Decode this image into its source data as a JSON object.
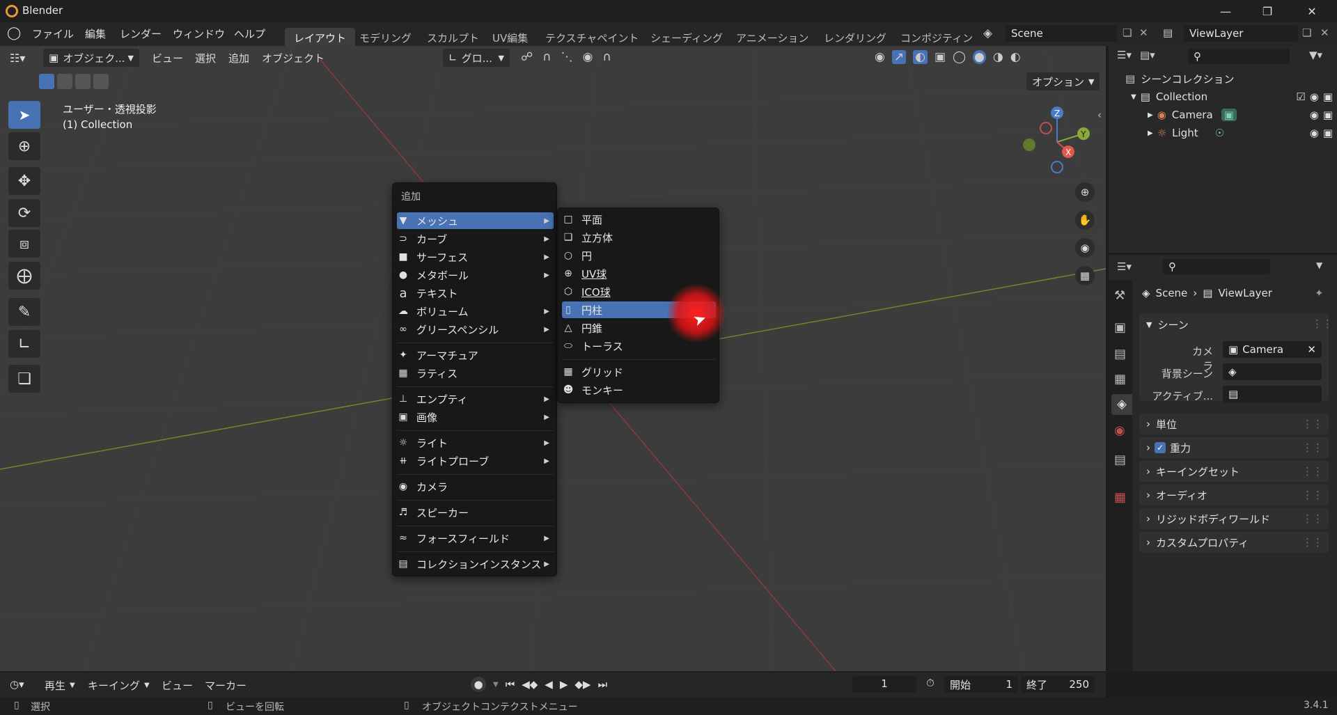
{
  "app": {
    "title": "Blender",
    "version": "3.4.1"
  },
  "menubar": [
    "ファイル",
    "編集",
    "レンダー",
    "ウィンドウ",
    "ヘルプ"
  ],
  "workspaces": [
    {
      "label": "レイアウト",
      "active": true
    },
    {
      "label": "モデリング"
    },
    {
      "label": "スカルプト"
    },
    {
      "label": "UV編集"
    },
    {
      "label": "テクスチャペイント"
    },
    {
      "label": "シェーディング"
    },
    {
      "label": "アニメーション"
    },
    {
      "label": "レンダリング"
    },
    {
      "label": "コンポジティン"
    }
  ],
  "scene": {
    "name": "Scene",
    "view_layer": "ViewLayer"
  },
  "viewport_header": {
    "mode": "オブジェク...",
    "menus": [
      "ビュー",
      "選択",
      "追加",
      "オブジェクト"
    ],
    "transform": "グロ...",
    "options": "オプション"
  },
  "viewport": {
    "overlay_line1": "ユーザー・透視投影",
    "overlay_line2": "(1) Collection",
    "gizmo": {
      "z": "Z",
      "y": "Y",
      "x": "X"
    }
  },
  "add_menu": {
    "title": "追加",
    "items": [
      {
        "label": "メッシュ",
        "icon": "mesh-icon",
        "sub": true,
        "highlight": true
      },
      {
        "label": "カーブ",
        "icon": "curve-icon",
        "sub": true
      },
      {
        "label": "サーフェス",
        "icon": "surface-icon",
        "sub": true
      },
      {
        "label": "メタボール",
        "icon": "metaball-icon",
        "sub": true
      },
      {
        "label": "テキスト",
        "icon": "text-icon"
      },
      {
        "label": "ボリューム",
        "icon": "volume-icon",
        "sub": true
      },
      {
        "label": "グリースペンシル",
        "icon": "grease-pencil-icon",
        "sub": true
      },
      {
        "label": "アーマチュア",
        "icon": "armature-icon"
      },
      {
        "label": "ラティス",
        "icon": "lattice-icon"
      },
      {
        "label": "エンプティ",
        "icon": "empty-icon",
        "sub": true
      },
      {
        "label": "画像",
        "icon": "image-icon",
        "sub": true
      },
      {
        "label": "ライト",
        "icon": "light-icon",
        "sub": true
      },
      {
        "label": "ライトプローブ",
        "icon": "light-probe-icon",
        "sub": true
      },
      {
        "label": "カメラ",
        "icon": "camera-icon"
      },
      {
        "label": "スピーカー",
        "icon": "speaker-icon"
      },
      {
        "label": "フォースフィールド",
        "icon": "force-field-icon",
        "sub": true
      },
      {
        "label": "コレクションインスタンス",
        "icon": "collection-instance-icon",
        "sub": true
      }
    ]
  },
  "mesh_submenu": {
    "items": [
      {
        "label": "平面",
        "icon": "plane-icon"
      },
      {
        "label": "立方体",
        "icon": "cube-icon"
      },
      {
        "label": "円",
        "icon": "circle-icon"
      },
      {
        "label": "UV球",
        "icon": "uv-sphere-icon"
      },
      {
        "label": "ICO球",
        "icon": "ico-sphere-icon"
      },
      {
        "label": "円柱",
        "icon": "cylinder-icon",
        "highlight": true
      },
      {
        "label": "円錐",
        "icon": "cone-icon"
      },
      {
        "label": "トーラス",
        "icon": "torus-icon"
      },
      {
        "label": "グリッド",
        "icon": "grid-icon"
      },
      {
        "label": "モンキー",
        "icon": "monkey-icon"
      }
    ]
  },
  "outliner": {
    "root": "シーンコレクション",
    "collection": "Collection",
    "objects": [
      "Camera",
      "Light"
    ]
  },
  "properties": {
    "breadcrumb_scene": "Scene",
    "breadcrumb_layer": "ViewLayer",
    "scene_panel": "シーン",
    "camera_label": "カメラ",
    "camera_value": "Camera",
    "background_label": "背景シーン",
    "active_label": "アクティブ...",
    "panels": [
      "単位",
      "重力",
      "キーイングセット",
      "オーディオ",
      "リジッドボディワールド",
      "カスタムプロパティ"
    ]
  },
  "timeline": {
    "menus": [
      "再生",
      "キーイング",
      "ビュー",
      "マーカー"
    ],
    "current_frame": "1",
    "start_label": "開始",
    "start": "1",
    "end_label": "終了",
    "end": "250"
  },
  "statusbar": {
    "select": "選択",
    "rotate": "ビューを回転",
    "context": "オブジェクトコンテクストメニュー"
  }
}
